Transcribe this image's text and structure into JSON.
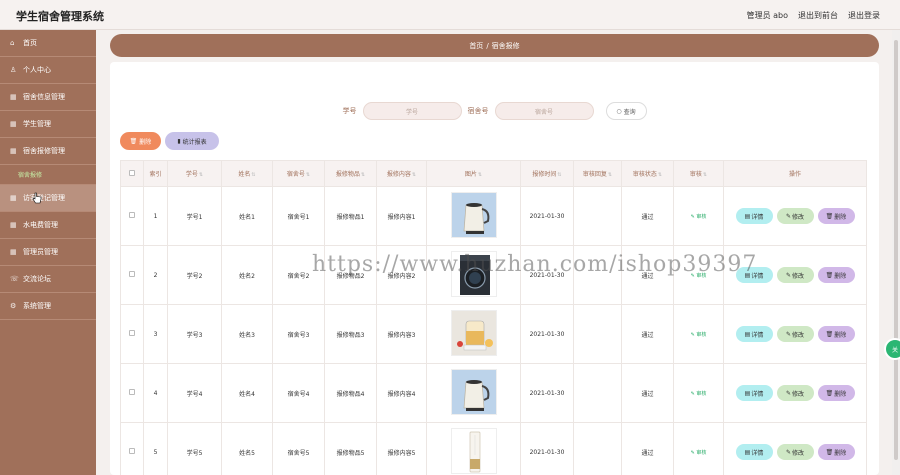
{
  "app": {
    "title": "学生宿舍管理系统",
    "user_label": "管理员 abo",
    "back_label": "退出到前台",
    "logout_label": "退出登录"
  },
  "sidebar": {
    "items": [
      {
        "label": "首页",
        "icon": "home-icon"
      },
      {
        "label": "个人中心",
        "icon": "user-icon"
      },
      {
        "label": "宿舍信息管理",
        "icon": "grid-icon"
      },
      {
        "label": "学生管理",
        "icon": "grid-icon"
      },
      {
        "label": "宿舍报修管理",
        "icon": "grid-icon"
      },
      {
        "label": "宿舍报修",
        "icon": ""
      },
      {
        "label": "访客登记管理",
        "icon": "grid-icon"
      },
      {
        "label": "水电费管理",
        "icon": "grid-icon"
      },
      {
        "label": "管理员管理",
        "icon": "grid-icon"
      },
      {
        "label": "交流论坛",
        "icon": "chat-icon"
      },
      {
        "label": "系统管理",
        "icon": "gear-icon"
      }
    ]
  },
  "breadcrumb": {
    "home": "首页",
    "sep": "/",
    "current": "宿舍报修"
  },
  "search": {
    "student_label": "学号",
    "student_placeholder": "学号",
    "room_label": "宿舍号",
    "room_placeholder": "宿舍号",
    "search_button": "查询"
  },
  "toolbar": {
    "delete_label": "删除",
    "report_label": "统计报表"
  },
  "table": {
    "headers": [
      "",
      "索引",
      "学号",
      "姓名",
      "宿舍号",
      "报修物品",
      "报修内容",
      "图片",
      "报修时间",
      "审核回复",
      "审核状态",
      "审核",
      "操作"
    ],
    "rows": [
      {
        "index": "1",
        "student_no": "学号1",
        "name": "姓名1",
        "room": "宿舍号1",
        "item": "报修物品1",
        "content": "报修内容1",
        "time": "2021-01-30",
        "reply": "",
        "status": "通过",
        "audit": "审核",
        "image": "kettle"
      },
      {
        "index": "2",
        "student_no": "学号2",
        "name": "姓名2",
        "room": "宿舍号2",
        "item": "报修物品2",
        "content": "报修内容2",
        "time": "2021-01-30",
        "reply": "",
        "status": "通过",
        "audit": "审核",
        "image": "washer"
      },
      {
        "index": "3",
        "student_no": "学号3",
        "name": "姓名3",
        "room": "宿舍号3",
        "item": "报修物品3",
        "content": "报修内容3",
        "time": "2021-01-30",
        "reply": "",
        "status": "通过",
        "audit": "审核",
        "image": "teapot"
      },
      {
        "index": "4",
        "student_no": "学号4",
        "name": "姓名4",
        "room": "宿舍号4",
        "item": "报修物品4",
        "content": "报修内容4",
        "time": "2021-01-30",
        "reply": "",
        "status": "通过",
        "audit": "审核",
        "image": "kettle"
      },
      {
        "index": "5",
        "student_no": "学号5",
        "name": "姓名5",
        "room": "宿舍号5",
        "item": "报修物品5",
        "content": "报修内容5",
        "time": "2021-01-30",
        "reply": "",
        "status": "通过",
        "audit": "审核",
        "image": "aircon"
      }
    ],
    "op_detail": "详情",
    "op_edit": "修改",
    "op_delete": "删除"
  },
  "watermark": "https://www.huzhan.com/ishop39397",
  "float_button": "关",
  "colors": {
    "brand": "#a0705a",
    "delete": "#f08a5d",
    "report": "#c7c2e9",
    "detail": "#b2eef0",
    "edit": "#cfe8c5",
    "op_delete": "#d1b8e8",
    "audit": "#2eae6c"
  }
}
